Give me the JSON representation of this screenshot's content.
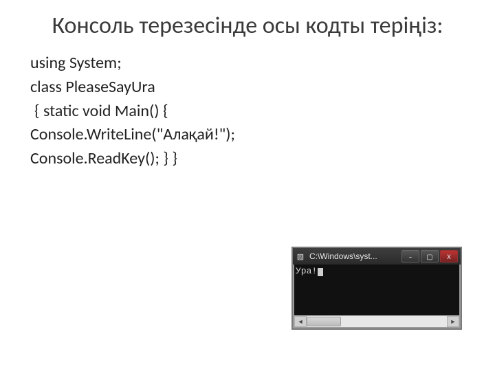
{
  "title": "Консоль терезесінде осы кодты теріңіз:",
  "code": {
    "l1": "using System;",
    "l2": "class PleaseSayUra",
    "l3": " { static void Main() {",
    "l4": "Console.WriteLine(\"Алақай!\");",
    "l5": "Console.ReadKey(); } }"
  },
  "console": {
    "window_title": "C:\\Windows\\syst...",
    "output": "Ура!",
    "buttons": {
      "min": "–",
      "max": "▢",
      "close": "X"
    },
    "icon_glyph": "▧",
    "scroll_left": "◄",
    "scroll_right": "►"
  }
}
